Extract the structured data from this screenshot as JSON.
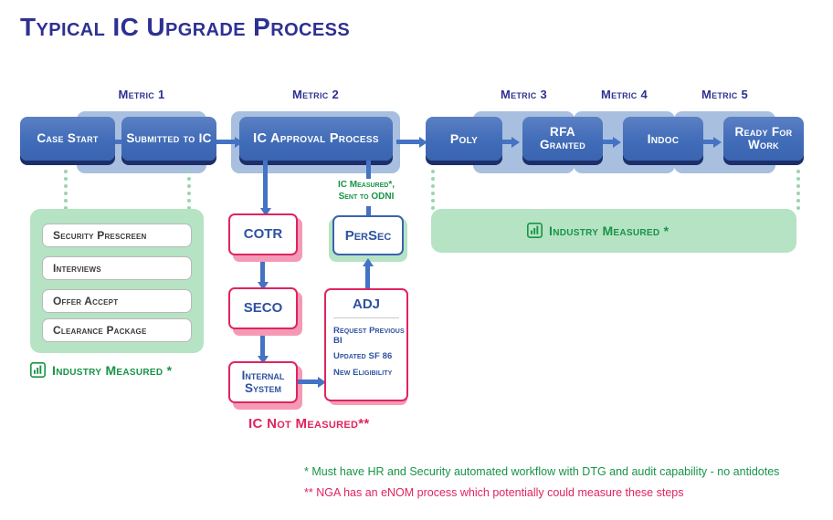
{
  "page": {
    "title": "Typical IC Upgrade Process"
  },
  "colors": {
    "title_blue": "#2e3192",
    "box_blue": "#416cb8",
    "box_shadow_navy": "#1c2f6b",
    "band_blue": "#a8bfdf",
    "arrow_blue": "#4472c4",
    "green": "#179447",
    "green_panel": "#b5e3c3",
    "green_dot": "#9bd4ae",
    "pink": "#e0245e",
    "pink_shadow": "#f59ab6",
    "sub_box_text": "#3a3a3a"
  },
  "metrics": [
    {
      "label": "Metric 1"
    },
    {
      "label": "Metric 2"
    },
    {
      "label": "Metric 3"
    },
    {
      "label": "Metric 4"
    },
    {
      "label": "Metric 5"
    }
  ],
  "flow_steps": [
    {
      "label": "Case Start"
    },
    {
      "label": "Submitted to IC"
    },
    {
      "label": "IC Approval Process"
    },
    {
      "label": "Poly"
    },
    {
      "label": "RFA Granted"
    },
    {
      "label": "Indoc"
    },
    {
      "label": "Ready For Work"
    }
  ],
  "left_panel": {
    "items": [
      {
        "label": "Security Prescreen"
      },
      {
        "label": "Interviews"
      },
      {
        "label": "Offer Accept"
      },
      {
        "label": "Clearance Package"
      }
    ],
    "measured_tag": "Industry Measured *",
    "icon": "bar-chart-icon"
  },
  "right_panel": {
    "measured_tag": "Industry Measured *",
    "icon": "bar-chart-icon"
  },
  "middle_flow": {
    "left_column": [
      {
        "label": "COTR"
      },
      {
        "label": "SECO"
      },
      {
        "label": "Internal System"
      }
    ],
    "persec": {
      "label": "PerSec"
    },
    "odni_note": "IC Measured*, Sent to ODNI",
    "odni_note_line1": "IC Measured*,",
    "odni_note_line2": "Sent to ODNI",
    "adj": {
      "title": "ADJ",
      "items": [
        {
          "label": "Request Previous BI"
        },
        {
          "label": "Updated SF 86"
        },
        {
          "label": "New Eligibility"
        }
      ]
    },
    "not_measured_tag": "IC Not Measured**"
  },
  "footnotes": [
    {
      "text": "* Must have HR and Security automated workflow with DTG and audit capability - no antidotes"
    },
    {
      "text": "** NGA has an eNOM process which potentially could measure these steps"
    }
  ]
}
